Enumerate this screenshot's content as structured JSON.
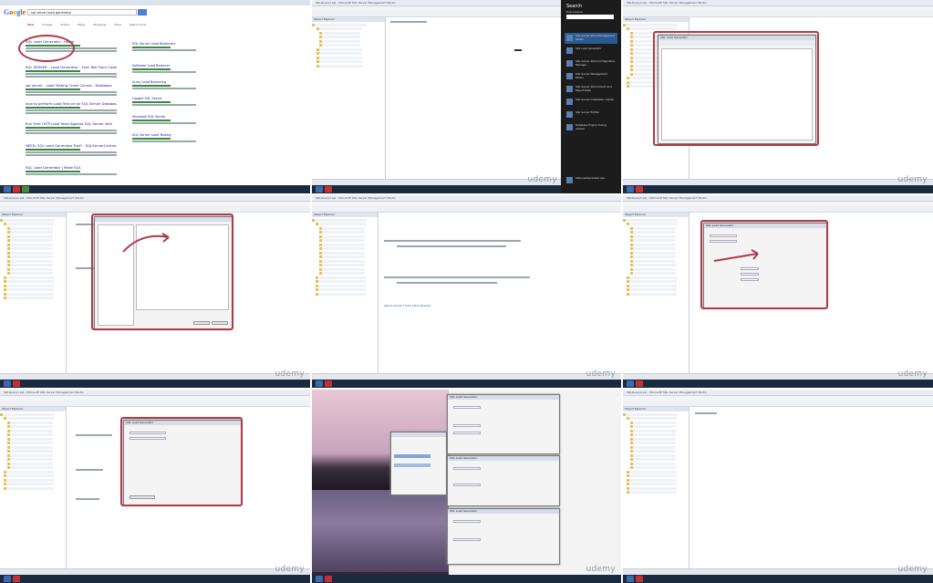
{
  "google": {
    "query": "sql server load generator",
    "tabs": [
      "Web",
      "Images",
      "Videos",
      "News",
      "Shopping",
      "More",
      "Search tools"
    ],
    "results": [
      "SQL Load Generator - Home",
      "SQL SERVER – Load Generator – Free Tool From CodePlex",
      "sql server - Load Testing Crash Course - Database",
      "how to perform Load Test on an SQL Server Database - MSD",
      "Run Free OLTP Load Tests Against SQL Server with",
      "NEED: SQL Load Generator Tool? - SQLServerCentral.com",
      "SQL Load Generator | Make SQL"
    ],
    "ads": [
      "SQL Server Load Balancers",
      "Software Load Balancer",
      "Array Load Balancing",
      "Google SQL Server",
      "Microsoft SQL Server",
      "SQL Server Load Testing"
    ]
  },
  "charm": {
    "title": "Search",
    "subtitle": "Everywhere",
    "items": [
      "SQL Server 2014 Management Studio",
      "SQL Load Generator",
      "SQL Server 2014 Configuration Manager",
      "SQL Server Management Studio",
      "SQL Server 2014 Import and Export Data",
      "SQL Server Installation Center",
      "SQL Server Profiler",
      "Database Engine Tuning Advisor",
      "SQLLoadGenerator.exe"
    ]
  },
  "ssms": {
    "title": "SQLQuery1.sql - Microsoft SQL Server Management Studio",
    "object_explorer": "Object Explorer",
    "dialog_title": "SQL Load Generator",
    "status_text": "Ready",
    "query_text": "select count(*) from [dbo].[Users]"
  },
  "watermark": "udemy"
}
